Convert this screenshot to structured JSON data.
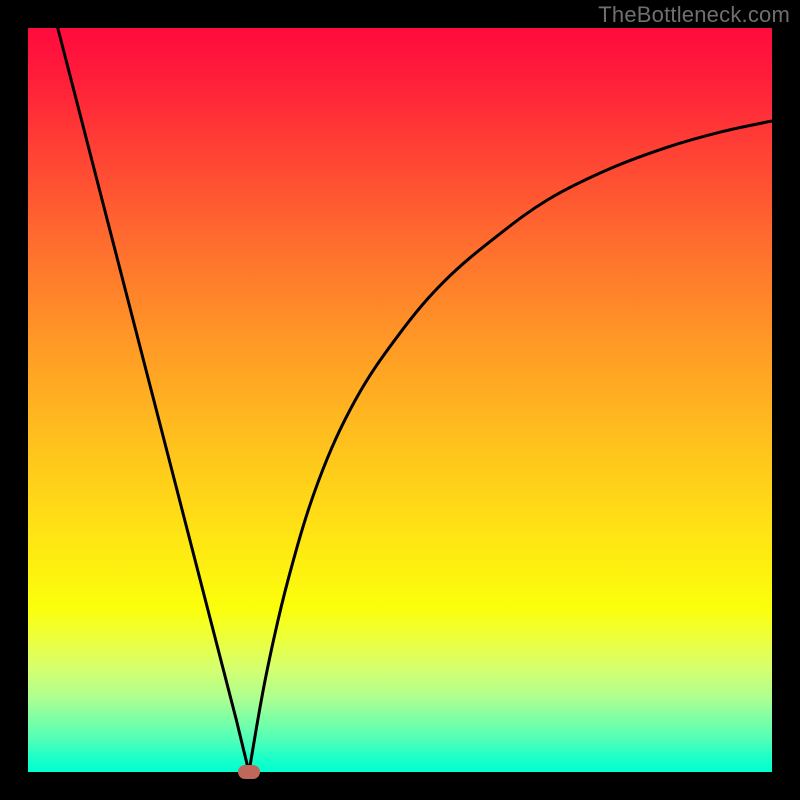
{
  "watermark": "TheBottleneck.com",
  "chart_data": {
    "type": "line",
    "title": "",
    "xlabel": "",
    "ylabel": "",
    "xlim": [
      0,
      1
    ],
    "ylim": [
      0,
      1
    ],
    "grid": false,
    "legend": false,
    "background_gradient": {
      "orientation": "vertical",
      "stops": [
        {
          "pos": 0.0,
          "color": "#ff0b3e"
        },
        {
          "pos": 0.15,
          "color": "#ff3c35"
        },
        {
          "pos": 0.42,
          "color": "#ff9826"
        },
        {
          "pos": 0.68,
          "color": "#ffe414"
        },
        {
          "pos": 0.82,
          "color": "#edff3b"
        },
        {
          "pos": 0.93,
          "color": "#7cffa6"
        },
        {
          "pos": 1.0,
          "color": "#00ffd0"
        }
      ]
    },
    "series": [
      {
        "name": "left-branch",
        "x": [
          0.04,
          0.08,
          0.12,
          0.16,
          0.2,
          0.24,
          0.28,
          0.297
        ],
        "y": [
          1.0,
          0.845,
          0.69,
          0.535,
          0.38,
          0.225,
          0.07,
          0.0
        ],
        "stroke": "#000000",
        "width": 3
      },
      {
        "name": "right-branch",
        "x": [
          0.297,
          0.32,
          0.35,
          0.39,
          0.44,
          0.5,
          0.56,
          0.63,
          0.7,
          0.78,
          0.86,
          0.93,
          1.0
        ],
        "y": [
          0.0,
          0.13,
          0.26,
          0.39,
          0.5,
          0.59,
          0.66,
          0.72,
          0.77,
          0.81,
          0.84,
          0.86,
          0.875
        ],
        "stroke": "#000000",
        "width": 3
      }
    ],
    "markers": [
      {
        "name": "bottleneck-point",
        "x": 0.297,
        "y": 0.0,
        "shape": "pill",
        "color": "#c0675b"
      }
    ],
    "border": {
      "color": "#000000",
      "width": 28
    }
  }
}
